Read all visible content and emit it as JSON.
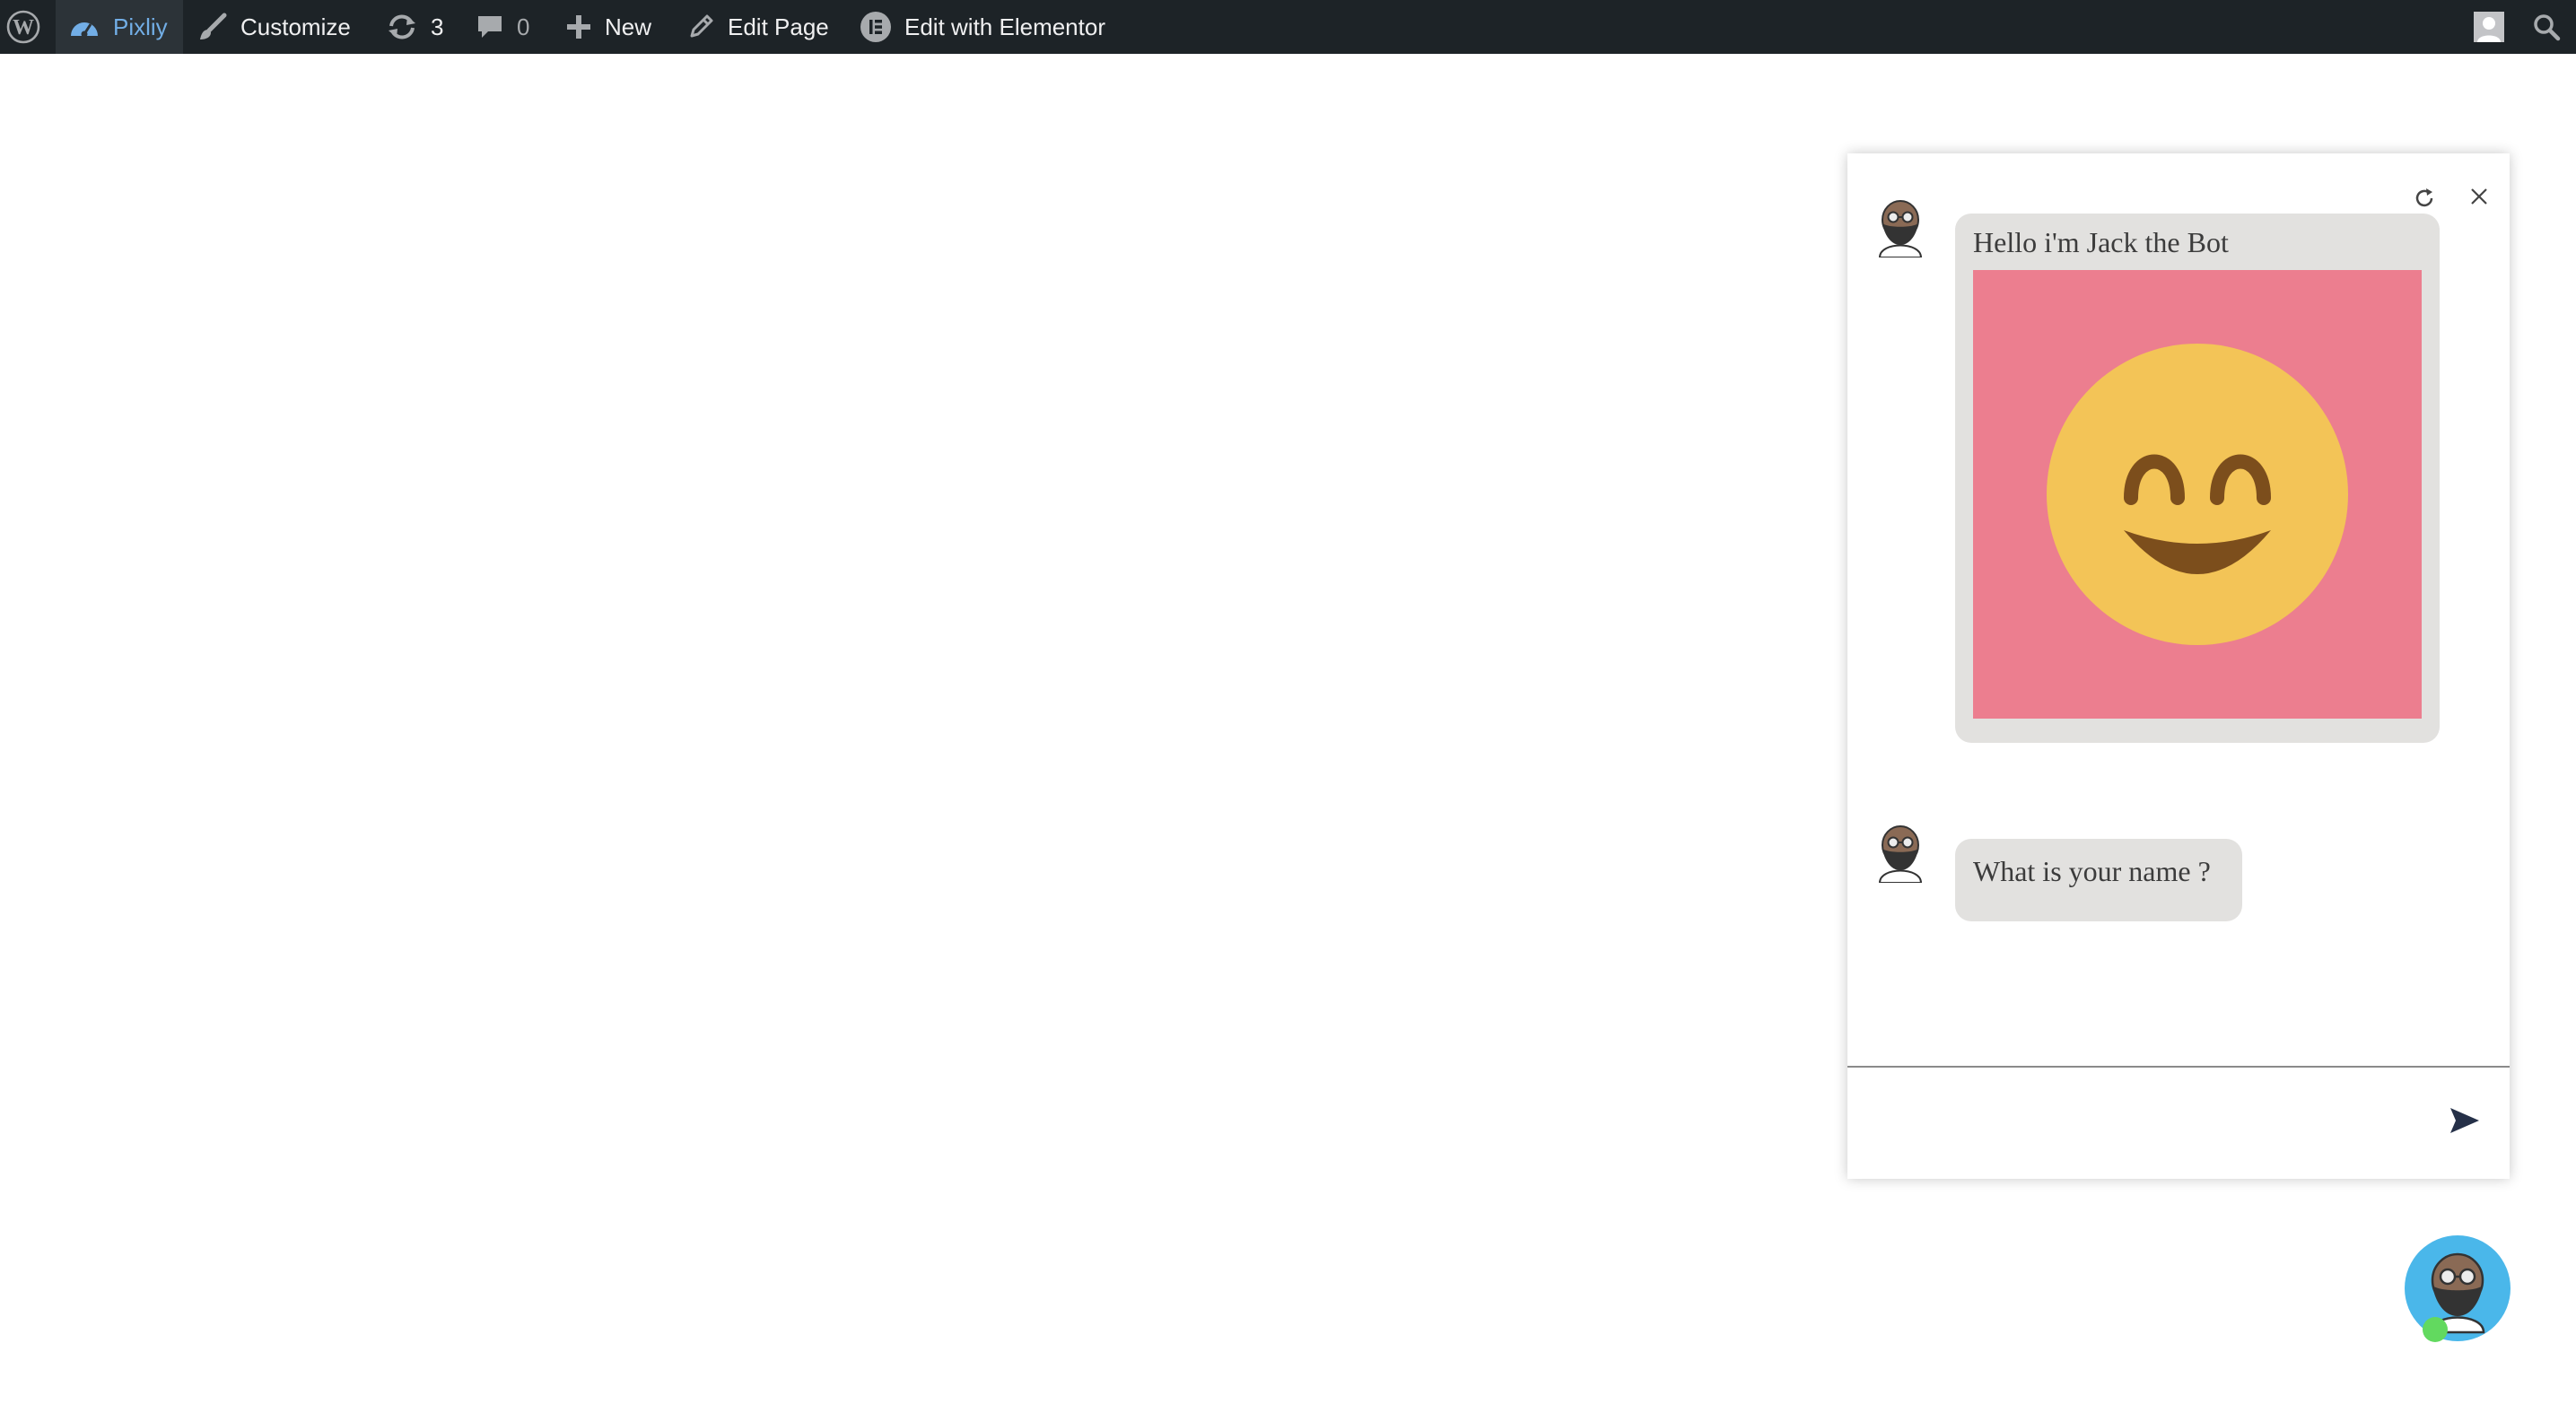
{
  "admin_bar": {
    "site_name": "Pixliy",
    "customize_label": "Customize",
    "updates_count": "3",
    "comments_count": "0",
    "new_label": "New",
    "edit_page_label": "Edit Page",
    "elementor_label": "Edit with Elementor",
    "icons": [
      "wordpress-logo-icon",
      "dashboard-icon",
      "brush-icon",
      "updates-icon",
      "comment-icon",
      "plus-icon",
      "pencil-icon",
      "elementor-icon",
      "user-avatar-icon",
      "search-icon"
    ]
  },
  "chat": {
    "messages": [
      {
        "sender": "bot",
        "text": "Hello i'm Jack the Bot",
        "attachment": "smiling-face-emoji"
      },
      {
        "sender": "bot",
        "text": "What is your name ?"
      }
    ],
    "input_value": "",
    "controls": [
      "refresh-icon",
      "close-icon",
      "send-icon"
    ]
  },
  "colors": {
    "admin_bar_bg": "#1d2327",
    "site_link": "#72aee6",
    "bubble_bg": "#e2e1df",
    "emoji_bg": "#ec7e8f",
    "emoji_face": "#f3c457",
    "emoji_features": "#7c4e1c",
    "launcher_bg": "#4ab7ea",
    "online_dot": "#62d95f"
  }
}
